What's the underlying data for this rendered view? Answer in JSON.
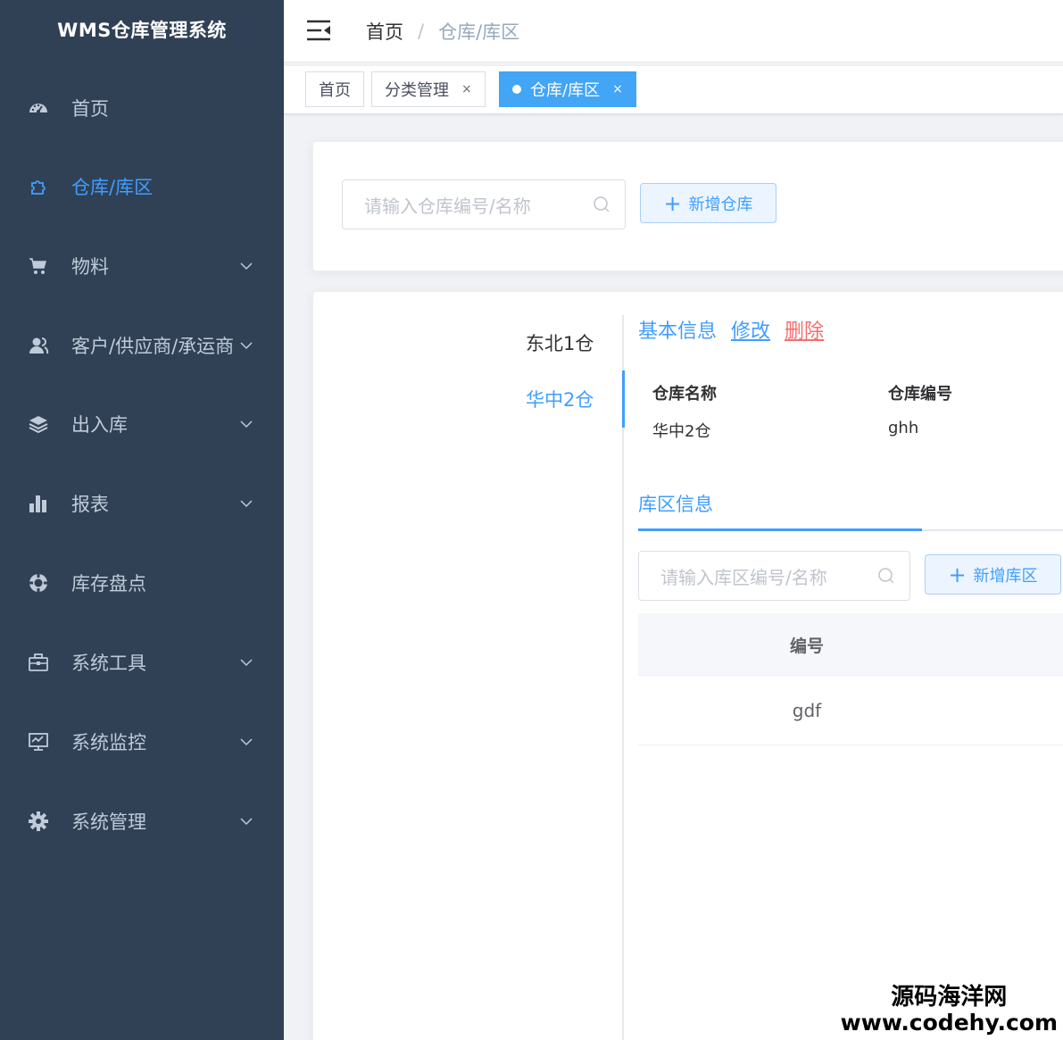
{
  "app": {
    "title": "WMS仓库管理系统"
  },
  "sidebar": {
    "items": [
      {
        "label": "首页",
        "icon": "dashboard-icon",
        "active": false,
        "has_arrow": false
      },
      {
        "label": "仓库/库区",
        "icon": "puzzle-icon",
        "active": true,
        "has_arrow": false
      },
      {
        "label": "物料",
        "icon": "cart-icon",
        "active": false,
        "has_arrow": true
      },
      {
        "label": "客户/供应商/承运商",
        "icon": "people-icon",
        "active": false,
        "has_arrow": true
      },
      {
        "label": "出入库",
        "icon": "layers-icon",
        "active": false,
        "has_arrow": true
      },
      {
        "label": "报表",
        "icon": "bar-chart-icon",
        "active": false,
        "has_arrow": true
      },
      {
        "label": "库存盘点",
        "icon": "lifebuoy-icon",
        "active": false,
        "has_arrow": false
      },
      {
        "label": "系统工具",
        "icon": "toolbox-icon",
        "active": false,
        "has_arrow": true
      },
      {
        "label": "系统监控",
        "icon": "monitor-icon",
        "active": false,
        "has_arrow": true
      },
      {
        "label": "系统管理",
        "icon": "gear-icon",
        "active": false,
        "has_arrow": true
      }
    ]
  },
  "navbar": {
    "breadcrumb": {
      "home": "首页",
      "separator": "/",
      "current": "仓库/库区"
    }
  },
  "tags": [
    {
      "label": "首页",
      "closable": false,
      "active": false
    },
    {
      "label": "分类管理",
      "closable": true,
      "active": false
    },
    {
      "label": "仓库/库区",
      "closable": true,
      "active": true
    }
  ],
  "tag_close_symbol": "×",
  "search": {
    "placeholder": "请输入仓库编号/名称",
    "add_button": "新增仓库"
  },
  "warehouses": {
    "items": [
      "东北1仓",
      "华中2仓"
    ],
    "selected": "华中2仓"
  },
  "basic_info": {
    "title": "基本信息",
    "edit": "修改",
    "delete": "删除",
    "name_label": "仓库名称",
    "name_value": "华中2仓",
    "code_label": "仓库编号",
    "code_value": "ghh"
  },
  "zone": {
    "tab_label": "库区信息",
    "search_placeholder": "请输入库区编号/名称",
    "add_button": "新增库区",
    "table": {
      "columns": [
        "编号"
      ],
      "rows": [
        [
          "gdf"
        ]
      ]
    }
  },
  "watermark": {
    "line1": "源码海洋网",
    "line2": "www.codehy.com"
  },
  "colors": {
    "sidebar_bg": "#304156",
    "sidebar_text": "#bfcbd9",
    "accent": "#409eff",
    "danger": "#f56c6c",
    "active_tag": "#42a5f5"
  }
}
